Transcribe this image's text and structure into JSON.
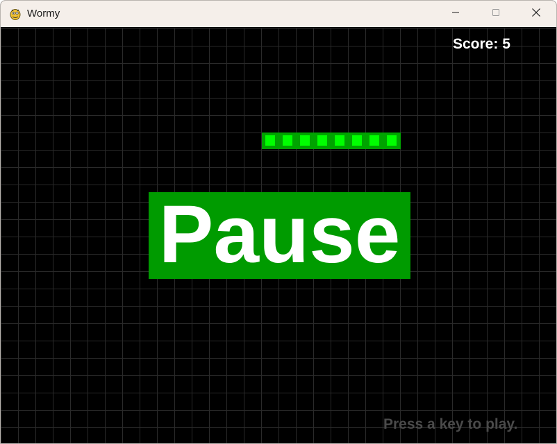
{
  "window": {
    "title": "Wormy",
    "icon": "pygame-snake-icon",
    "controls": [
      "minimize-icon",
      "maximize-icon",
      "close-icon"
    ]
  },
  "game": {
    "score_text": "Score: 5",
    "pause_text": "Pause",
    "prompt_text": "Press a key to play.",
    "worm_segments": 8,
    "colors": {
      "background": "#000000",
      "grid": "#2a2a2a",
      "worm_outer": "#00a300",
      "worm_inner": "#00ff00",
      "pause_bg": "#009b00",
      "pause_text": "#ffffff",
      "score_text": "#ffffff",
      "prompt_text": "#4a4a4a"
    }
  }
}
